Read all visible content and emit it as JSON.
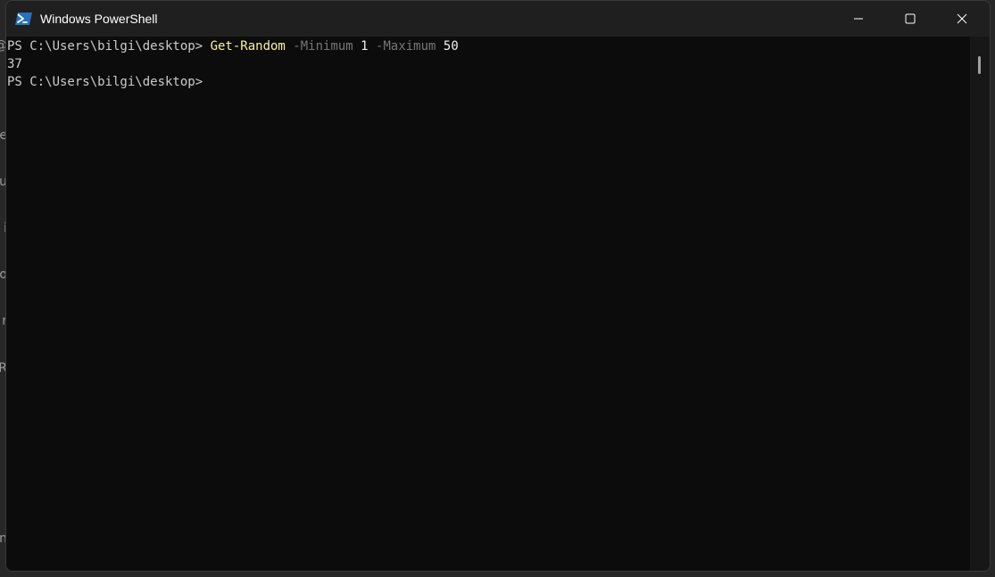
{
  "window": {
    "title": "Windows PowerShell",
    "icon": "powershell-icon",
    "controls": {
      "minimize_icon": "minimize-icon",
      "maximize_icon": "maximize-icon",
      "close_icon": "close-icon"
    }
  },
  "console": {
    "lines": [
      {
        "prompt": "PS C:\\Users\\bilgi\\desktop> ",
        "command": "Get-Random",
        "param1_name": " -Minimum ",
        "param1_value": "1",
        "param2_name": " -Maximum ",
        "param2_value": "50"
      },
      {
        "output": "37"
      },
      {
        "prompt": "PS C:\\Users\\bilgi\\desktop>"
      }
    ]
  },
  "colors": {
    "background": "#0c0c0c",
    "titlebar": "#1f1f1f",
    "text": "#cccccc",
    "command": "#f9f1a5",
    "parameter": "#767676"
  },
  "background_window_fragments": [
    "@",
    "ke",
    "u",
    "i",
    "o",
    "r",
    "R",
    "n"
  ]
}
